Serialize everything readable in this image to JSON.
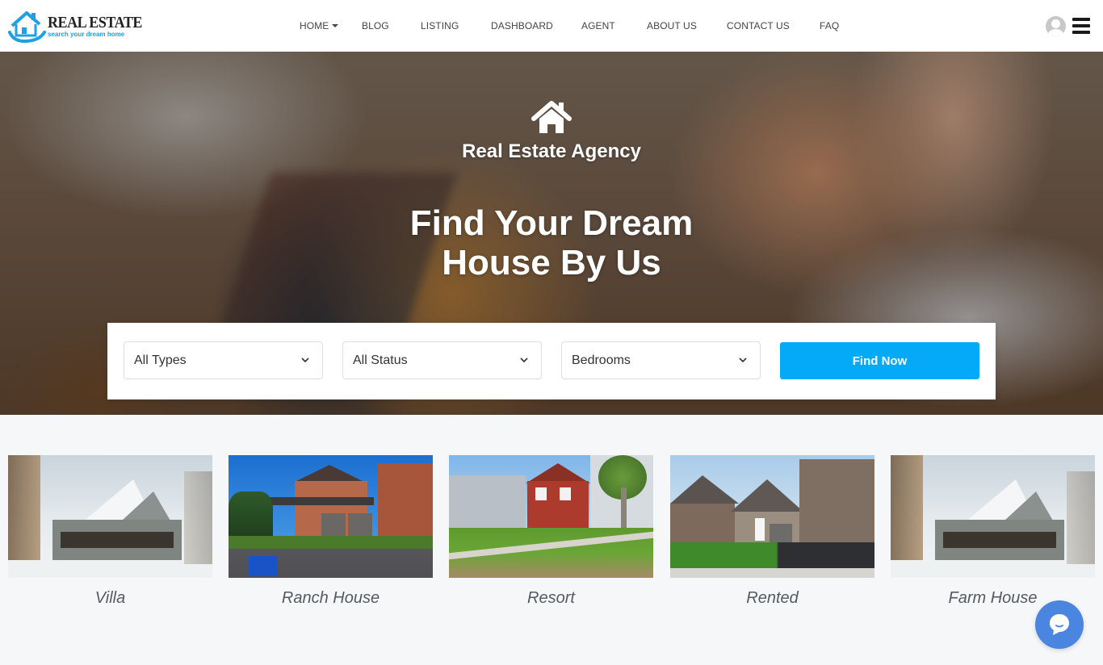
{
  "header": {
    "logo": {
      "title": "REAL ESTATE",
      "tagline": "search your dream home",
      "icon": "house-logo-icon"
    },
    "nav": [
      {
        "label": "HOME",
        "has_dropdown": true
      },
      {
        "label": "BLOG"
      },
      {
        "label": "LISTING"
      },
      {
        "label": "DASHBOARD"
      },
      {
        "label": "AGENT"
      },
      {
        "label": "ABOUT US"
      },
      {
        "label": "CONTACT US"
      },
      {
        "label": "FAQ"
      }
    ],
    "user_icon": "user-avatar-icon",
    "menu_icon": "hamburger-menu-icon"
  },
  "hero": {
    "icon": "home-icon",
    "agency_title": "Real Estate Agency",
    "headline_line1": "Find Your Dream",
    "headline_line2": "House By Us"
  },
  "search": {
    "type_select": {
      "value": "All Types"
    },
    "status_select": {
      "value": "All Status"
    },
    "bedrooms_select": {
      "value": "Bedrooms"
    },
    "find_button": "Find Now"
  },
  "property_types": [
    {
      "label": "Villa"
    },
    {
      "label": "Ranch House"
    },
    {
      "label": "Resort"
    },
    {
      "label": "Rented"
    },
    {
      "label": "Farm House"
    }
  ],
  "chat": {
    "icon": "chat-bubble-icon"
  },
  "colors": {
    "primary": "#04aaf7",
    "chat": "#4a86e0",
    "logo_blue": "#1e9fe6"
  }
}
